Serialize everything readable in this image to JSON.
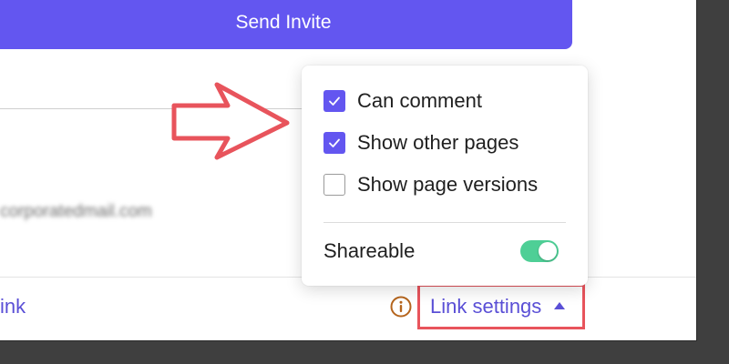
{
  "invite": {
    "send_label": "Send Invite"
  },
  "member": {
    "email_blurred": "corporatedmail.com"
  },
  "footer": {
    "copy_link_label": "ink",
    "link_settings_label": "Link settings"
  },
  "popover": {
    "options": [
      {
        "label": "Can comment",
        "checked": true
      },
      {
        "label": "Show other pages",
        "checked": true
      },
      {
        "label": "Show page versions",
        "checked": false
      }
    ],
    "shareable_label": "Shareable",
    "shareable_on": true
  },
  "colors": {
    "accent": "#6356f0",
    "link": "#5a4fd6",
    "highlight_box": "#e8545c",
    "toggle_on": "#4ecf96",
    "info_icon": "#b5651d"
  },
  "icons": [
    "info-icon",
    "caret-up-icon",
    "checkmark-icon",
    "annotation-arrow-icon"
  ]
}
